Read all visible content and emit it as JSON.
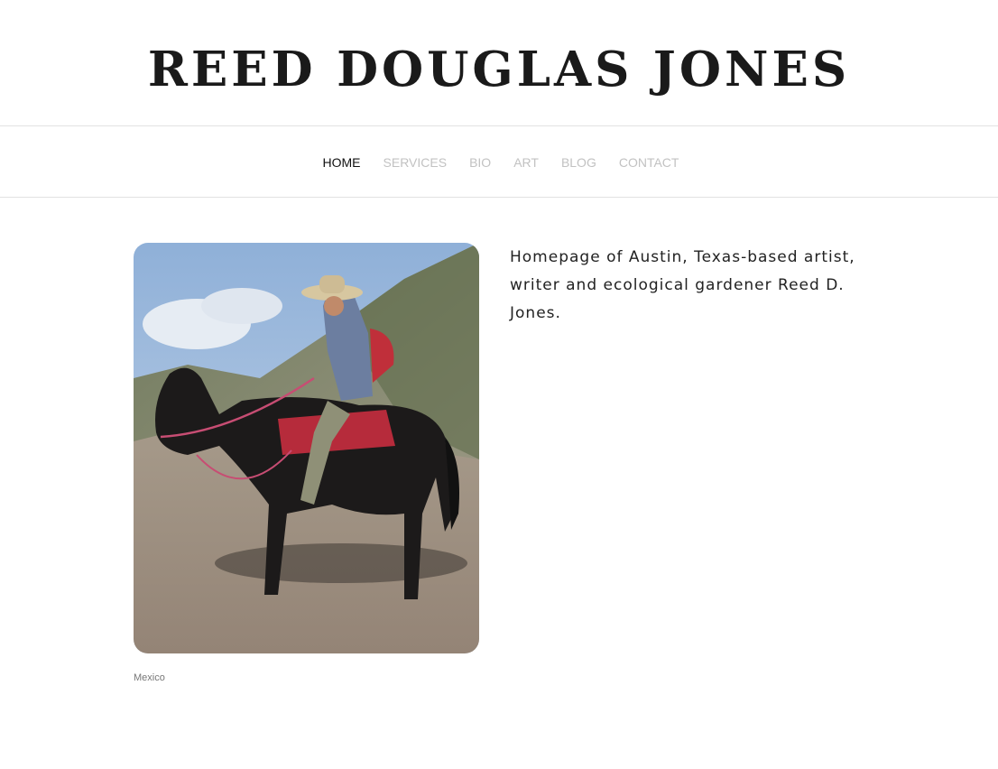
{
  "site": {
    "title": "Reed Douglas Jones"
  },
  "nav": {
    "items": [
      {
        "label": "HOME",
        "active": true
      },
      {
        "label": "SERVICES",
        "active": false
      },
      {
        "label": "BIO",
        "active": false
      },
      {
        "label": "ART",
        "active": false
      },
      {
        "label": "BLOG",
        "active": false
      },
      {
        "label": "CONTACT",
        "active": false
      }
    ]
  },
  "main": {
    "photo_caption": "Mexico",
    "intro_text": "Homepage of Austin, Texas-based artist, writer and ecological gardener Reed D. Jones."
  },
  "colors": {
    "nav_active": "#111111",
    "nav_inactive": "#c2c2c2",
    "divider": "#e2e2e2"
  }
}
